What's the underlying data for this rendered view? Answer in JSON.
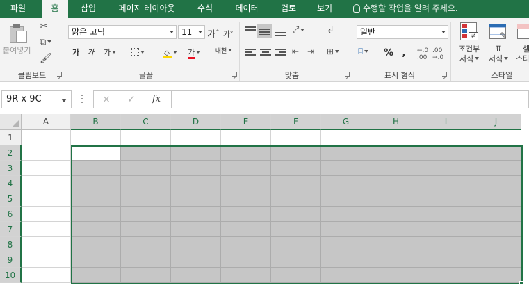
{
  "ribbon_tabs": [
    {
      "label": "파일",
      "active": false
    },
    {
      "label": "홈",
      "active": true
    },
    {
      "label": "삽입",
      "active": false
    },
    {
      "label": "페이지 레이아웃",
      "active": false
    },
    {
      "label": "수식",
      "active": false
    },
    {
      "label": "데이터",
      "active": false
    },
    {
      "label": "검토",
      "active": false
    },
    {
      "label": "보기",
      "active": false
    }
  ],
  "tell_me": {
    "placeholder": "수행할 작업을 알려 주세요."
  },
  "clipboard": {
    "paste_label": "붙여넣기",
    "group_label": "클립보드"
  },
  "font": {
    "name": "맑은 고딕",
    "size": "11",
    "grow_label": "가",
    "shrink_label": "가",
    "bold_label": "가",
    "italic_label": "가",
    "underline_label": "가",
    "font_color_label": "가",
    "phonetic_label": "내천",
    "group_label": "글꼴",
    "font_color": "#e81123",
    "fill_color": "#ffd700"
  },
  "alignment": {
    "group_label": "맞춤"
  },
  "number": {
    "format": "일반",
    "percent_label": "%",
    "comma_label": ",",
    "group_label": "표시 형식"
  },
  "styles": {
    "conditional_label_1": "조건부",
    "conditional_label_2": "서식",
    "table_label_1": "표",
    "table_label_2": "서식",
    "cell_styles_label": "셀",
    "cell_styles_label_2": "스타일",
    "group_label": "스타일"
  },
  "formula_bar": {
    "name_box": "9R x 9C",
    "cancel_icon": "×",
    "enter_icon": "✓",
    "fx_label": "fx",
    "value": ""
  },
  "sheet": {
    "columns": [
      "A",
      "B",
      "C",
      "D",
      "E",
      "F",
      "G",
      "H",
      "I",
      "J"
    ],
    "rows": [
      "1",
      "2",
      "3",
      "4",
      "5",
      "6",
      "7",
      "8",
      "9",
      "10"
    ],
    "selected_range": "B2:J10",
    "active_cell": "B2"
  },
  "colors": {
    "accent": "#217346",
    "selection_fill": "#c6c6c6",
    "ribbon_bg": "#f3f3f3"
  }
}
